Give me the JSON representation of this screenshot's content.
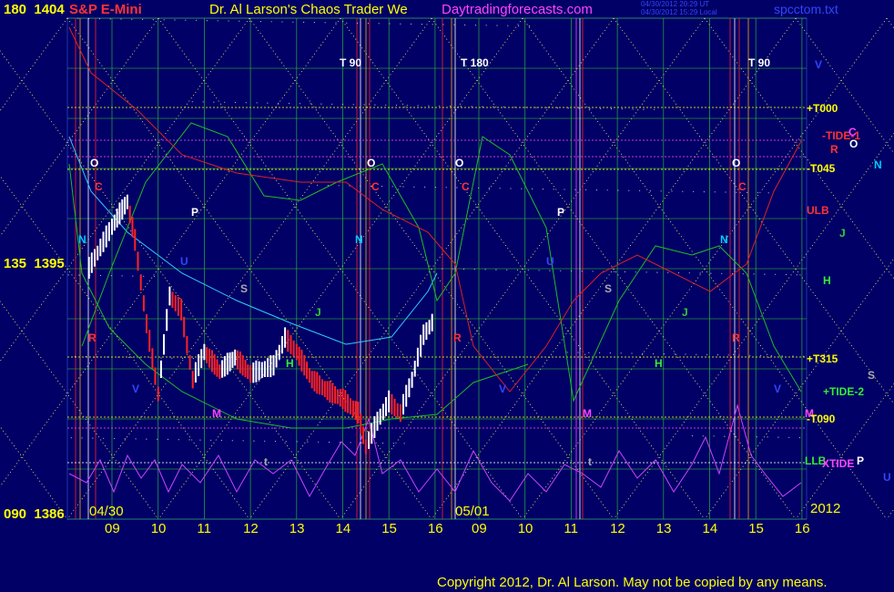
{
  "header": {
    "symbol": "S&P E-Mini",
    "title": "Dr. Al Larson's Chaos Trader We",
    "site": "Daytradingforecasts.com",
    "time_ut": "04/30/2012 20:29 UT",
    "time_local": "04/30/2012 15:29 Local",
    "file": "spcctom.txt"
  },
  "price_axis": {
    "labels": [
      {
        "angle": "180",
        "price": "1404"
      },
      {
        "angle": "135",
        "price": "1395"
      },
      {
        "angle": "090",
        "price": "1386"
      }
    ]
  },
  "time_axis": {
    "dates": [
      "04/30",
      "05/01"
    ],
    "hours_day1": [
      "09",
      "10",
      "11",
      "12",
      "13",
      "14",
      "15",
      "16"
    ],
    "hours_day2": [
      "09",
      "10",
      "11",
      "12",
      "13",
      "14",
      "15",
      "16"
    ],
    "year": "2012"
  },
  "right_labels": [
    {
      "text": "V",
      "color": "#3344ff"
    },
    {
      "text": "+T000",
      "color": "#ffff00"
    },
    {
      "text": "-TIDE-1",
      "color": "#ff3333"
    },
    {
      "text": "C",
      "color": "#ff44ff"
    },
    {
      "text": "R",
      "color": "#ff3333"
    },
    {
      "text": "O",
      "color": "#ffffff"
    },
    {
      "text": "-T045",
      "color": "#ffff00"
    },
    {
      "text": "N",
      "color": "#00ccff"
    },
    {
      "text": "ULB",
      "color": "#ff3333"
    },
    {
      "text": "J",
      "color": "#33cc33"
    },
    {
      "text": "H",
      "color": "#33ee33"
    },
    {
      "text": "+T315",
      "color": "#ffff00"
    },
    {
      "text": "S",
      "color": "#aaaaaa"
    },
    {
      "text": "+TIDE-2",
      "color": "#33ee33"
    },
    {
      "text": "M",
      "color": "#ff44ff"
    },
    {
      "text": "-T090",
      "color": "#ffff00"
    },
    {
      "text": "LLB",
      "color": "#33ee33"
    },
    {
      "text": "XTIDE",
      "color": "#ff44ff"
    },
    {
      "text": "P",
      "color": "#ffffff"
    },
    {
      "text": "U",
      "color": "#3344ff"
    }
  ],
  "top_markers": [
    {
      "text": "T 90",
      "color": "#ffffff"
    },
    {
      "text": "T 180",
      "color": "#ffffff"
    },
    {
      "text": "T 90",
      "color": "#ffffff"
    }
  ],
  "planet_markers": [
    {
      "text": "O",
      "color": "#ffffff"
    },
    {
      "text": "C",
      "color": "#ff3333"
    },
    {
      "text": "P",
      "color": "#ffffff"
    },
    {
      "text": "N",
      "color": "#00ccff"
    },
    {
      "text": "S",
      "color": "#aaaaaa"
    },
    {
      "text": "J",
      "color": "#33cc33"
    },
    {
      "text": "H",
      "color": "#33ee33"
    },
    {
      "text": "V",
      "color": "#3344ff"
    },
    {
      "text": "M",
      "color": "#ff44ff"
    },
    {
      "text": "U",
      "color": "#3344ff"
    },
    {
      "text": "R",
      "color": "#ff3333"
    },
    {
      "text": "t",
      "color": "#aaaaaa"
    }
  ],
  "copyright": "Copyright 2012, Dr. Al Larson. May not be copied by any means.",
  "colors": {
    "background": "#000066",
    "grid_green": "#33cc33",
    "grid_yellow": "#ffff66",
    "price_up": "#ffffff",
    "price_down": "#ff2222",
    "field_cyan": "#33ccff",
    "field_magenta": "#cc44ff",
    "field_red": "#dd2222",
    "field_green": "#22bb22"
  },
  "chart_data": {
    "type": "line",
    "title": "S&P E-Mini",
    "ylim": [
      1386,
      1404
    ],
    "y_ticks": [
      1386,
      1395,
      1404
    ],
    "x_ticks": [
      "09",
      "10",
      "11",
      "12",
      "13",
      "14",
      "15",
      "16",
      "09",
      "10",
      "11",
      "12",
      "13",
      "14",
      "15",
      "16"
    ],
    "series": [
      {
        "name": "S&P E-Mini",
        "color": "#ff2222",
        "x": [
          "04/30 08:30",
          "04/30 09:00",
          "04/30 09:20",
          "04/30 09:30",
          "04/30 09:45",
          "04/30 10:00",
          "04/30 10:15",
          "04/30 10:30",
          "04/30 10:45",
          "04/30 11:00",
          "04/30 11:20",
          "04/30 11:40",
          "04/30 12:00",
          "04/30 12:30",
          "04/30 12:45",
          "04/30 13:00",
          "04/30 13:20",
          "04/30 13:40",
          "04/30 14:00",
          "04/30 14:20",
          "04/30 14:30",
          "04/30 14:45",
          "04/30 15:00",
          "04/30 15:15",
          "04/30 15:30",
          "04/30 15:45",
          "04/30 16:00"
        ],
        "values": [
          1395.0,
          1396.5,
          1397.4,
          1396.0,
          1393.0,
          1390.5,
          1394.0,
          1393.5,
          1391.0,
          1392.0,
          1391.3,
          1391.8,
          1391.2,
          1391.5,
          1392.5,
          1392.0,
          1391.0,
          1390.6,
          1390.3,
          1389.8,
          1388.6,
          1389.5,
          1390.2,
          1389.8,
          1391.0,
          1392.6,
          1393.2
        ]
      }
    ]
  }
}
